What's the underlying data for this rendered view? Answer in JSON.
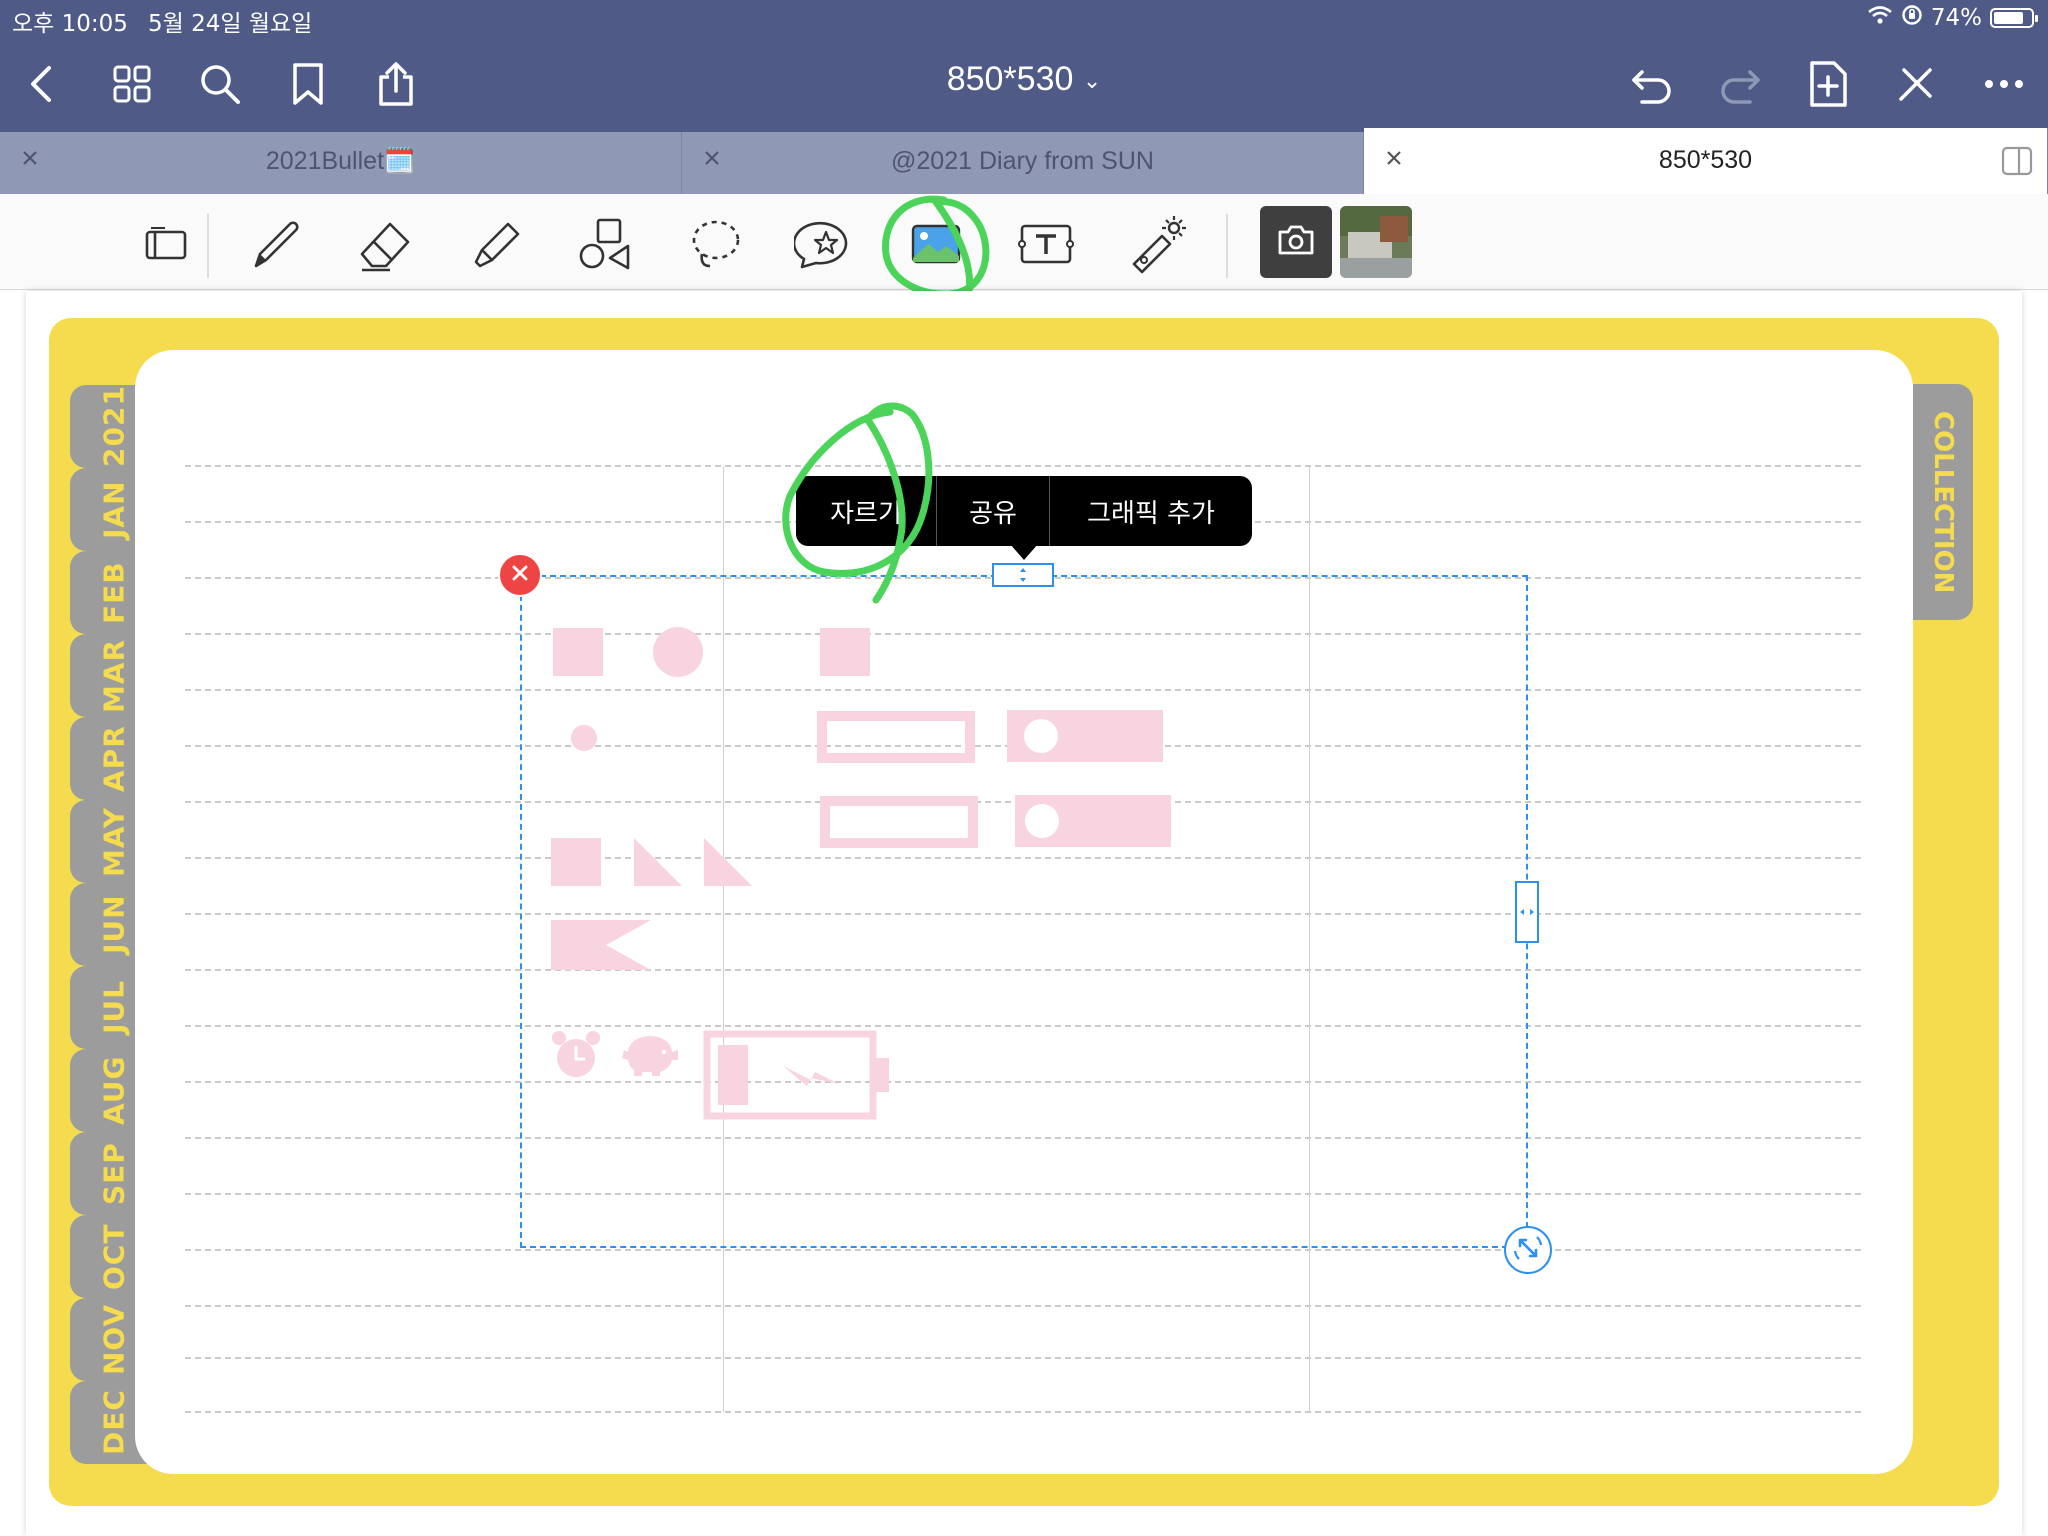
{
  "status_bar": {
    "time": "오후 10:05",
    "date": "5월 24일 월요일",
    "battery": "74%",
    "battery_level": 0.74
  },
  "header": {
    "title": "850*530"
  },
  "tabs": [
    {
      "label": "2021Bullet🗓️"
    },
    {
      "label": "@2021 Diary from SUN"
    },
    {
      "label": "850*530"
    }
  ],
  "binder": {
    "months": [
      "2021",
      "JAN",
      "FEB",
      "MAR",
      "APR",
      "MAY",
      "JUN",
      "JUL",
      "AUG",
      "SEP",
      "OCT",
      "NOV",
      "DEC"
    ],
    "collection": "COLLECTION"
  },
  "context_menu": {
    "cut": "자르기",
    "share": "공유",
    "add_graphic": "그래픽 추가"
  },
  "colors": {
    "header": "#4f5b86",
    "tabs": "#8f98b5",
    "binder": "#f4dc4e",
    "tab_gray": "#9c9c9c",
    "pink": "#f7d4df",
    "selection": "#2d8ff0",
    "annotation": "#4cd35a"
  }
}
